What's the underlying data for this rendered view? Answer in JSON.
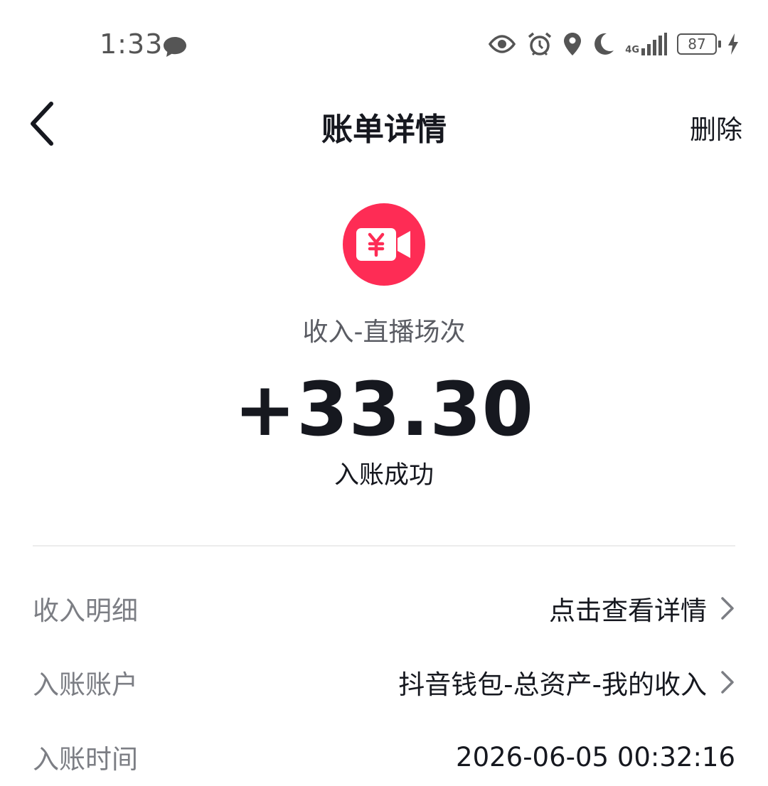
{
  "status_bar": {
    "time": "1:33",
    "network": "4G",
    "battery": "87",
    "icons": [
      "chat-icon",
      "eye-icon",
      "alarm-icon",
      "location-icon",
      "moon-icon",
      "signal-icon",
      "battery-icon",
      "charging-icon"
    ]
  },
  "header": {
    "title": "账单详情",
    "delete_label": "删除",
    "back_icon": "chevron-left-icon"
  },
  "summary": {
    "icon": "yuan-video-icon",
    "category": "收入-直播场次",
    "amount": "+33.30",
    "status": "入账成功"
  },
  "details": [
    {
      "label": "收入明细",
      "value": "点击查看详情",
      "has_arrow": true
    },
    {
      "label": "入账账户",
      "value": "抖音钱包-总资产-我的收入",
      "has_arrow": true
    },
    {
      "label": "入账时间",
      "value": "2026-06-05 00:32:16",
      "has_arrow": false
    }
  ],
  "colors": {
    "accent": "#fe2c55",
    "text_primary": "#16181f",
    "text_secondary": "#7c7e84"
  }
}
